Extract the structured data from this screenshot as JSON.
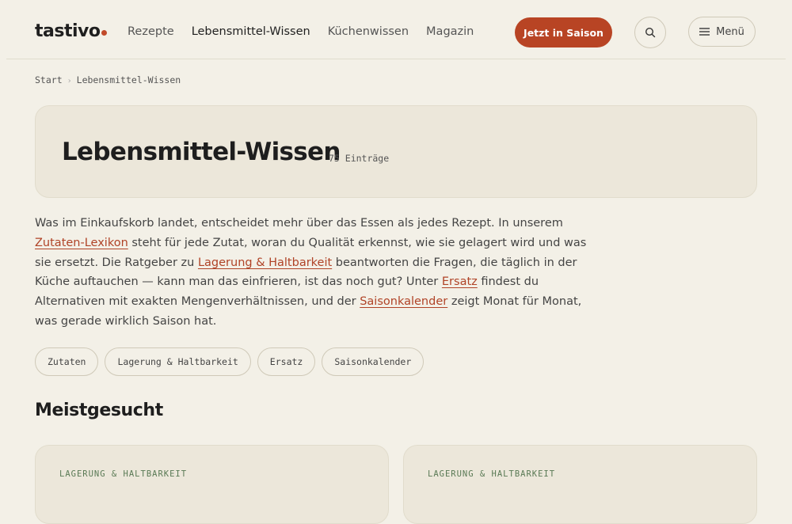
{
  "header": {
    "logo": "tastivo",
    "nav": [
      "Rezepte",
      "Lebensmittel-Wissen",
      "Küchenwissen",
      "Magazin"
    ],
    "active_nav": "Lebensmittel-Wissen",
    "season_button": "Jetzt in Saison",
    "menu_button": "Menü"
  },
  "breadcrumb": {
    "home": "Start",
    "current": "Lebensmittel-Wissen"
  },
  "hero": {
    "title": "Lebensmittel-Wissen",
    "count": "75 Einträge"
  },
  "intro": {
    "t1": "Was im Einkaufskorb landet, entscheidet mehr über das Essen als jedes Rezept. In unserem ",
    "l1": "Zutaten-Lexikon",
    "t2": " steht für jede Zutat, woran du Qualität erkennst, wie sie gelagert wird und was sie ersetzt. Die Ratgeber zu ",
    "l2": "Lagerung & Haltbarkeit",
    "t3": " beantworten die Fragen, die täglich in der Küche auftauchen — kann man das einfrieren, ist das noch gut? Unter ",
    "l3": "Ersatz",
    "t4": " findest du Alternativen mit exakten Mengenverhältnissen, und der ",
    "l4": "Saisonkalender",
    "t5": " zeigt Monat für Monat, was gerade wirklich Saison hat."
  },
  "chips": [
    "Zutaten",
    "Lagerung & Haltbarkeit",
    "Ersatz",
    "Saisonkalender"
  ],
  "section_title": "Meistgesucht",
  "cards": [
    {
      "category": "LAGERUNG & HALTBARKEIT",
      "title": ""
    },
    {
      "category": "LAGERUNG & HALTBARKEIT",
      "title": ""
    }
  ],
  "colors": {
    "accent": "#b84424",
    "background": "#f3f0e7",
    "card": "#ece7da"
  },
  "icons": {
    "search": "search-icon",
    "menu": "hamburger-icon"
  }
}
